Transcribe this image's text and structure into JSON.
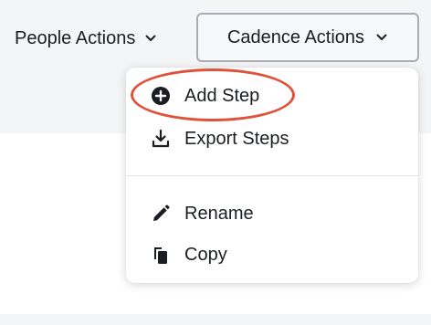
{
  "toolbar": {
    "people_actions_label": "People Actions",
    "cadence_actions_label": "Cadence Actions"
  },
  "menu": {
    "items": [
      {
        "label": "Add Step",
        "icon": "plus-circle-icon"
      },
      {
        "label": "Export Steps",
        "icon": "download-icon"
      },
      {
        "label": "Rename",
        "icon": "pencil-icon"
      },
      {
        "label": "Copy",
        "icon": "copy-icon"
      }
    ]
  },
  "colors": {
    "highlight_ring": "#e0513a",
    "text": "#1b1d24",
    "toolbar_bg": "#f4f5f7",
    "button_border": "#a9acb3"
  }
}
